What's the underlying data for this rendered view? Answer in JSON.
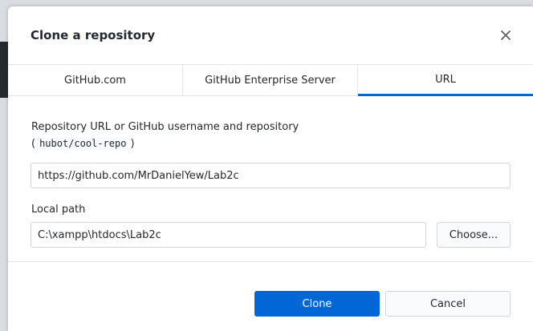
{
  "dialog": {
    "title": "Clone a repository",
    "close_icon": "close-icon"
  },
  "tabs": [
    {
      "label": "GitHub.com",
      "selected": false
    },
    {
      "label": "GitHub Enterprise Server",
      "selected": false
    },
    {
      "label": "URL",
      "selected": true
    }
  ],
  "form": {
    "repo_label": "Repository URL or GitHub username and repository",
    "repo_hint_open": "(",
    "repo_hint_code": "hubot/cool-repo",
    "repo_hint_close": ")",
    "repo_value": "https://github.com/MrDanielYew/Lab2c",
    "local_path_label": "Local path",
    "local_path_value": "C:\\xampp\\htdocs\\Lab2c",
    "choose_label": "Choose..."
  },
  "footer": {
    "clone_label": "Clone",
    "cancel_label": "Cancel"
  },
  "colors": {
    "accent": "#0366d6",
    "text": "#24292e",
    "border": "#e1e4e8"
  }
}
